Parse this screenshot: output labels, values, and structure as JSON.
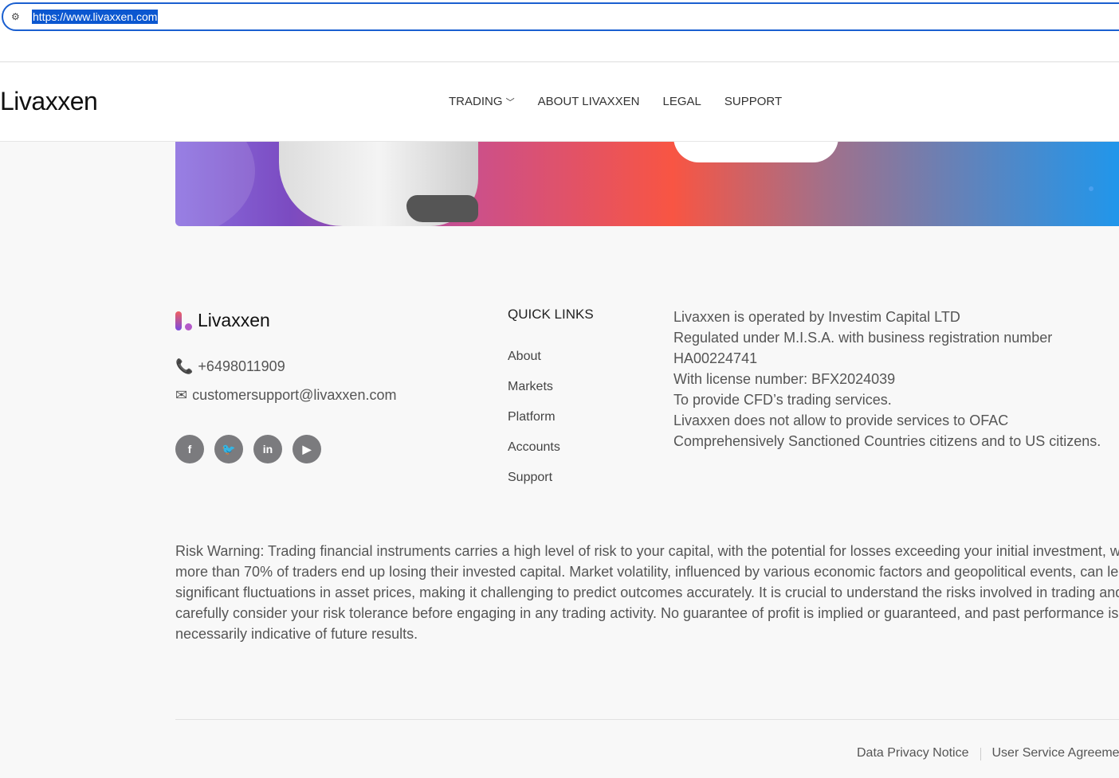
{
  "browser": {
    "url": "https://www.livaxxen.com"
  },
  "header": {
    "brand": "Livaxxen",
    "nav": [
      {
        "label": "TRADING"
      },
      {
        "label": "ABOUT LIVAXXEN"
      },
      {
        "label": "LEGAL"
      },
      {
        "label": "SUPPORT"
      }
    ]
  },
  "footer": {
    "brand": "Livaxxen",
    "phone": "+6498011909",
    "email": "customersupport@livaxxen.com",
    "quick_links_title": "QUICK LINKS",
    "quick_links": [
      "About",
      "Markets",
      "Platform",
      "Accounts",
      "Support"
    ],
    "legal_lines": [
      "Livaxxen is operated by Investim Capital LTD",
      "Regulated under M.I.S.A. with business registration number",
      "HA00224741",
      "With license number: BFX2024039",
      "To provide CFD’s trading services.",
      "Livaxxen does not allow to provide services to OFAC",
      "Comprehensively Sanctioned Countries citizens and to US citizens."
    ],
    "risk_warning": "Risk Warning: Trading financial instruments carries a high level of risk to your capital, with the potential for losses exceeding your initial investment, where more than 70% of traders end up losing their invested capital. Market volatility, influenced by various economic factors and geopolitical events, can lead to significant fluctuations in asset prices, making it challenging to predict outcomes accurately. It is crucial to understand the risks involved in trading and to carefully consider your risk tolerance before engaging in any trading activity. No guarantee of profit is implied or guaranteed, and past performance is not necessarily indicative of future results.",
    "bottom_links": [
      "Data Privacy Notice",
      "User Service Agreement"
    ]
  }
}
